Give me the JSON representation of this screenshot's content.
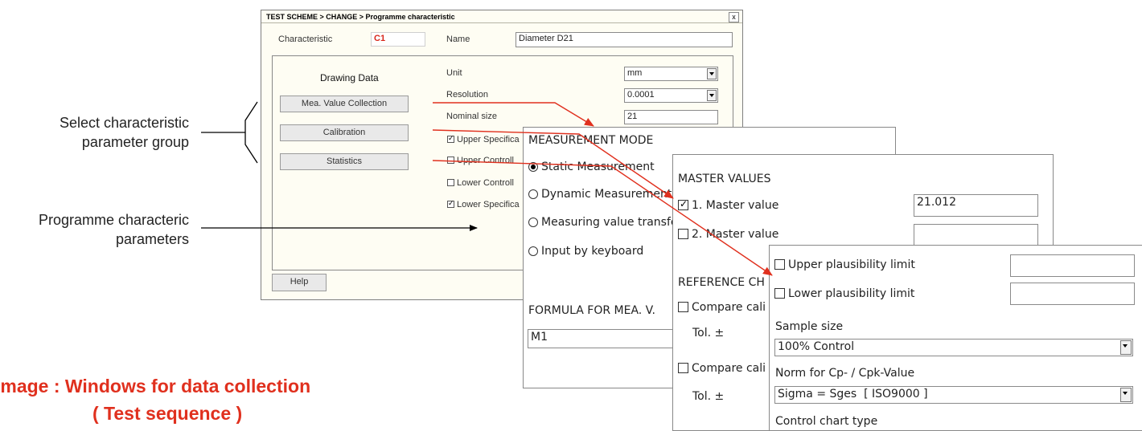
{
  "dialog": {
    "title": "TEST SCHEME > CHANGE > Programme characteristic",
    "close_label": "x",
    "characteristic_label": "Characteristic",
    "characteristic_value": "C1",
    "name_label": "Name",
    "name_value": "Diameter D21",
    "drawing_data_label": "Drawing Data",
    "buttons": {
      "mea_value_collection": "Mea. Value Collection",
      "calibration": "Calibration",
      "statistics": "Statistics",
      "help": "Help"
    },
    "unit_label": "Unit",
    "unit_value": "mm",
    "resolution_label": "Resolution",
    "resolution_value": "0.0001",
    "nominal_size_label": "Nominal size",
    "nominal_size_value": "21",
    "checks": [
      {
        "label": "Upper Specifica",
        "checked": true
      },
      {
        "label": "Upper Controll",
        "checked": false
      },
      {
        "label": "Lower Controll",
        "checked": false
      },
      {
        "label": "Lower Specifica",
        "checked": true
      }
    ]
  },
  "measurement_panel": {
    "heading": "MEASUREMENT MODE",
    "options": [
      {
        "label": "Static Measurement",
        "selected": true
      },
      {
        "label": "Dynamic Measurement",
        "selected": false
      },
      {
        "label": "Measuring value transfe",
        "selected": false
      },
      {
        "label": "Input by keyboard",
        "selected": false
      }
    ],
    "formula_heading": "FORMULA FOR MEA. V.",
    "formula_value": "M1"
  },
  "master_panel": {
    "heading": "MASTER VALUES",
    "master1_label": "1. Master value",
    "master1_checked": true,
    "master1_value": "21.012",
    "master2_label": "2. Master value",
    "master2_checked": false,
    "master2_value": "",
    "reference_heading": "REFERENCE CH",
    "compare1_label": "Compare cali",
    "tol1_label": "Tol. ±",
    "compare2_label": "Compare cali",
    "tol2_label": "Tol. ±"
  },
  "statistics_panel": {
    "upper_plausibility_label": "Upper plausibility limit",
    "upper_plausibility_value": "",
    "lower_plausibility_label": "Lower plausibility limit",
    "lower_plausibility_value": "",
    "sample_size_label": "Sample size",
    "sample_size_value": "100% Control",
    "norm_label": "Norm for Cp- / Cpk-Value",
    "norm_value": "Sigma = Sges  [ ISO9000 ]",
    "control_chart_label": "Control chart type"
  },
  "captions": {
    "select_group_line1": "Select characteristic",
    "select_group_line2": "parameter group",
    "programme_line1": "Programme characteric",
    "programme_line2": "parameters",
    "image_title_line1": "Image :  Windows for data collection",
    "image_title_line2": "( Test sequence )"
  },
  "colors": {
    "accent_red": "#e0301e",
    "dialog_bg": "#fefdf3"
  }
}
